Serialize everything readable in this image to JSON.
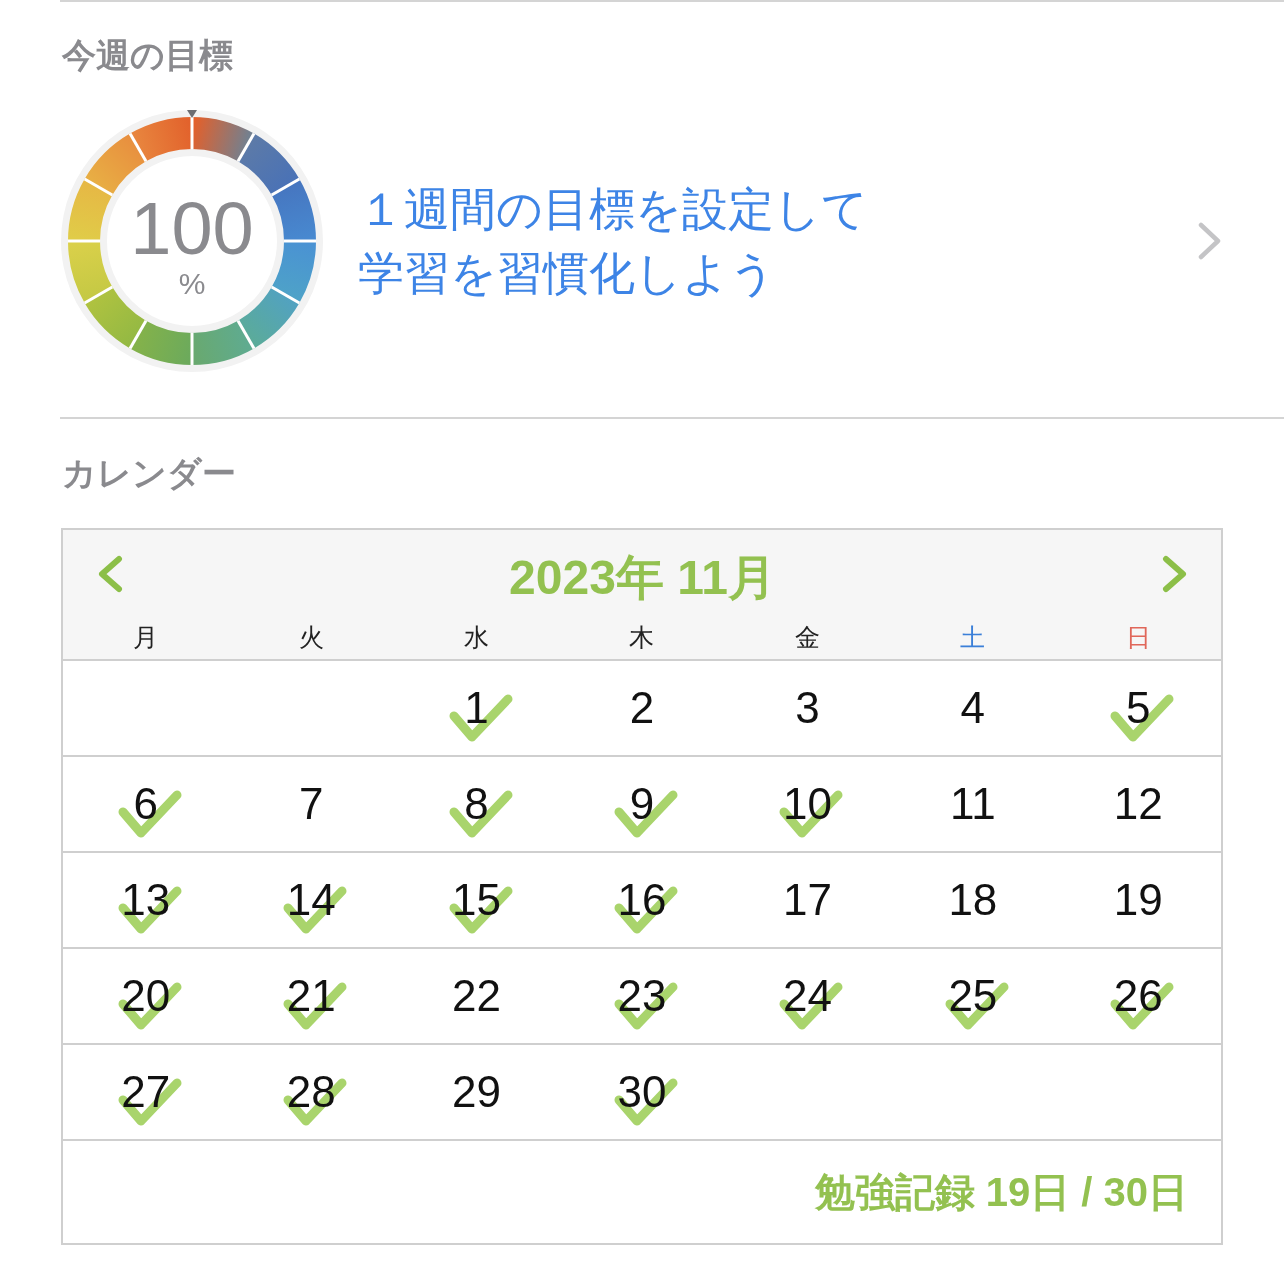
{
  "goal_section": {
    "title": "今週の目標",
    "meter": {
      "value": "100",
      "unit": "%"
    },
    "prompt": "１週間の目標を設定して学習を習慣化しよう"
  },
  "calendar_section": {
    "title": "カレンダー",
    "calendar": {
      "month_title": "2023年 11月",
      "weekdays": [
        {
          "label": "月",
          "color": "#222222"
        },
        {
          "label": "火",
          "color": "#222222"
        },
        {
          "label": "水",
          "color": "#222222"
        },
        {
          "label": "木",
          "color": "#222222"
        },
        {
          "label": "金",
          "color": "#222222"
        },
        {
          "label": "土",
          "color": "#3b7fd8"
        },
        {
          "label": "日",
          "color": "#e0675a"
        }
      ],
      "weeks": [
        [
          {
            "kind": "blank"
          },
          {
            "kind": "blank"
          },
          {
            "kind": "day",
            "day": "1",
            "checked": true
          },
          {
            "kind": "day",
            "day": "2",
            "checked": false
          },
          {
            "kind": "day",
            "day": "3",
            "checked": false
          },
          {
            "kind": "day",
            "day": "4",
            "checked": false
          },
          {
            "kind": "day",
            "day": "5",
            "checked": true
          }
        ],
        [
          {
            "kind": "day",
            "day": "6",
            "checked": true
          },
          {
            "kind": "day",
            "day": "7",
            "checked": false
          },
          {
            "kind": "day",
            "day": "8",
            "checked": true
          },
          {
            "kind": "day",
            "day": "9",
            "checked": true
          },
          {
            "kind": "day",
            "day": "10",
            "checked": true
          },
          {
            "kind": "day",
            "day": "11",
            "checked": false
          },
          {
            "kind": "day",
            "day": "12",
            "checked": false
          }
        ],
        [
          {
            "kind": "day",
            "day": "13",
            "checked": true
          },
          {
            "kind": "day",
            "day": "14",
            "checked": true
          },
          {
            "kind": "day",
            "day": "15",
            "checked": true
          },
          {
            "kind": "day",
            "day": "16",
            "checked": true
          },
          {
            "kind": "day",
            "day": "17",
            "checked": false
          },
          {
            "kind": "day",
            "day": "18",
            "checked": false
          },
          {
            "kind": "day",
            "day": "19",
            "checked": false
          }
        ],
        [
          {
            "kind": "day",
            "day": "20",
            "checked": true
          },
          {
            "kind": "day",
            "day": "21",
            "checked": true
          },
          {
            "kind": "day",
            "day": "22",
            "checked": false
          },
          {
            "kind": "day",
            "day": "23",
            "checked": true
          },
          {
            "kind": "day",
            "day": "24",
            "checked": true
          },
          {
            "kind": "day",
            "day": "25",
            "checked": true
          },
          {
            "kind": "day",
            "day": "26",
            "checked": true
          }
        ],
        [
          {
            "kind": "day",
            "day": "27",
            "checked": true
          },
          {
            "kind": "day",
            "day": "28",
            "checked": true
          },
          {
            "kind": "day",
            "day": "29",
            "checked": false
          },
          {
            "kind": "day",
            "day": "30",
            "checked": true
          },
          {
            "kind": "blank"
          },
          {
            "kind": "blank"
          },
          {
            "kind": "blank"
          }
        ]
      ],
      "footer": "勉強記録 19日 / 30日"
    }
  }
}
